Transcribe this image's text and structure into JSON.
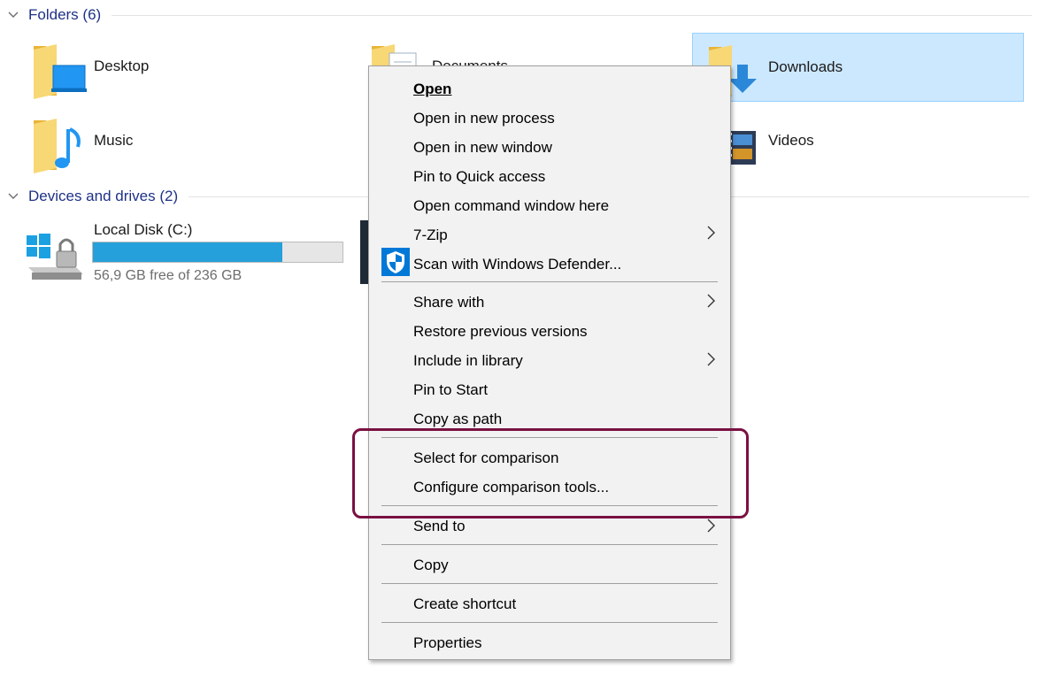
{
  "folders_group": {
    "title": "Folders (6)"
  },
  "folders": [
    {
      "name": "Desktop"
    },
    {
      "name": "Documents"
    },
    {
      "name": "Downloads",
      "selected": true
    },
    {
      "name": "Music"
    },
    {
      "name": "Videos"
    }
  ],
  "drives_group": {
    "title": "Devices and drives (2)"
  },
  "drives": [
    {
      "name": "Local Disk (C:)",
      "free_text": "56,9 GB free of 236 GB",
      "used_fraction": 0.759
    }
  ],
  "context_menu": {
    "open": "Open",
    "open_new_process": "Open in new process",
    "open_new_window": "Open in new window",
    "pin_quick_access": "Pin to Quick access",
    "open_cmd_here": "Open command window here",
    "seven_zip": "7-Zip",
    "scan_defender": "Scan with Windows Defender...",
    "share_with": "Share with",
    "restore_versions": "Restore previous versions",
    "include_library": "Include in library",
    "pin_start": "Pin to Start",
    "copy_as_path": "Copy as path",
    "select_comparison": "Select for comparison",
    "configure_comparison": "Configure comparison tools...",
    "send_to": "Send to",
    "copy": "Copy",
    "create_shortcut": "Create shortcut",
    "properties": "Properties"
  },
  "colors": {
    "group_title": "#1e3287",
    "selection_bg": "#cce8ff",
    "drive_fill": "#26a0da",
    "highlight_border": "#7a1142",
    "menu_bg": "#f2f2f2"
  }
}
